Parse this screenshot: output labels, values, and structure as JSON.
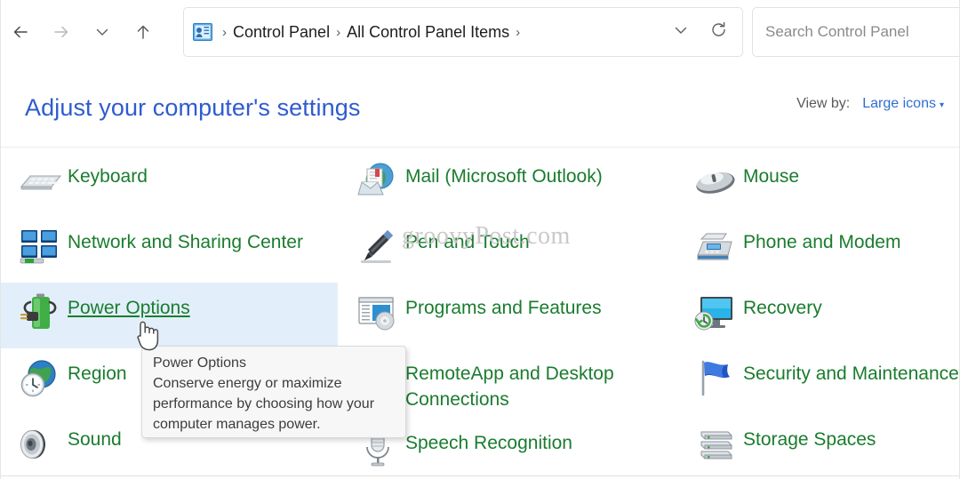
{
  "window": {
    "bottom_edge": ""
  },
  "toolbar": {
    "back_icon": "back-arrow-icon",
    "forward_icon": "forward-arrow-icon",
    "history_icon": "chevron-down-icon",
    "up_icon": "up-arrow-icon",
    "address": {
      "app_icon": "control-panel-icon",
      "separator": "›",
      "crumbs": [
        {
          "label": "Control Panel"
        },
        {
          "label": "All Control Panel Items"
        }
      ],
      "dropdown_icon": "chevron-down-icon",
      "refresh_icon": "refresh-icon"
    },
    "search": {
      "placeholder": "Search Control Panel",
      "value": ""
    }
  },
  "header": {
    "title": "Adjust your computer's settings",
    "view_by_label": "View by:",
    "view_by_value": "Large icons",
    "view_by_caret": "▾"
  },
  "watermark": {
    "text": "groovyPost.com"
  },
  "items": {
    "columns": [
      [
        {
          "label": "Keyboard",
          "icon": "keyboard-icon",
          "selected": false
        },
        {
          "label": "Network and Sharing Center",
          "icon": "network-sharing-icon",
          "selected": false
        },
        {
          "label": "Power Options",
          "icon": "power-options-icon",
          "selected": true
        },
        {
          "label": "Region",
          "icon": "region-icon",
          "selected": false
        },
        {
          "label": "Sound",
          "icon": "sound-icon",
          "selected": false
        }
      ],
      [
        {
          "label": "Mail (Microsoft Outlook)",
          "icon": "mail-outlook-icon",
          "selected": false
        },
        {
          "label": "Pen and Touch",
          "icon": "pen-touch-icon",
          "selected": false
        },
        {
          "label": "Programs and Features",
          "icon": "programs-features-icon",
          "selected": false
        },
        {
          "label": "RemoteApp and Desktop Connections",
          "icon": "remoteapp-icon",
          "selected": false
        },
        {
          "label": "Speech Recognition",
          "icon": "speech-recognition-icon",
          "selected": false
        }
      ],
      [
        {
          "label": "Mouse",
          "icon": "mouse-icon",
          "selected": false
        },
        {
          "label": "Phone and Modem",
          "icon": "phone-modem-icon",
          "selected": false
        },
        {
          "label": "Recovery",
          "icon": "recovery-icon",
          "selected": false
        },
        {
          "label": "Security and Maintenance",
          "icon": "security-maintenance-icon",
          "selected": false
        },
        {
          "label": "Storage Spaces",
          "icon": "storage-spaces-icon",
          "selected": false
        }
      ]
    ]
  },
  "tooltip": {
    "title": "Power Options",
    "body": "Conserve energy or maximize performance by choosing how your computer manages power."
  },
  "colors": {
    "link_green": "#1a7c2e",
    "heading_blue": "#2f5bd0",
    "accent_blue": "#2f6fd0",
    "selection_blue": "#e2effb",
    "tooltip_bg": "#f7f7f7"
  }
}
